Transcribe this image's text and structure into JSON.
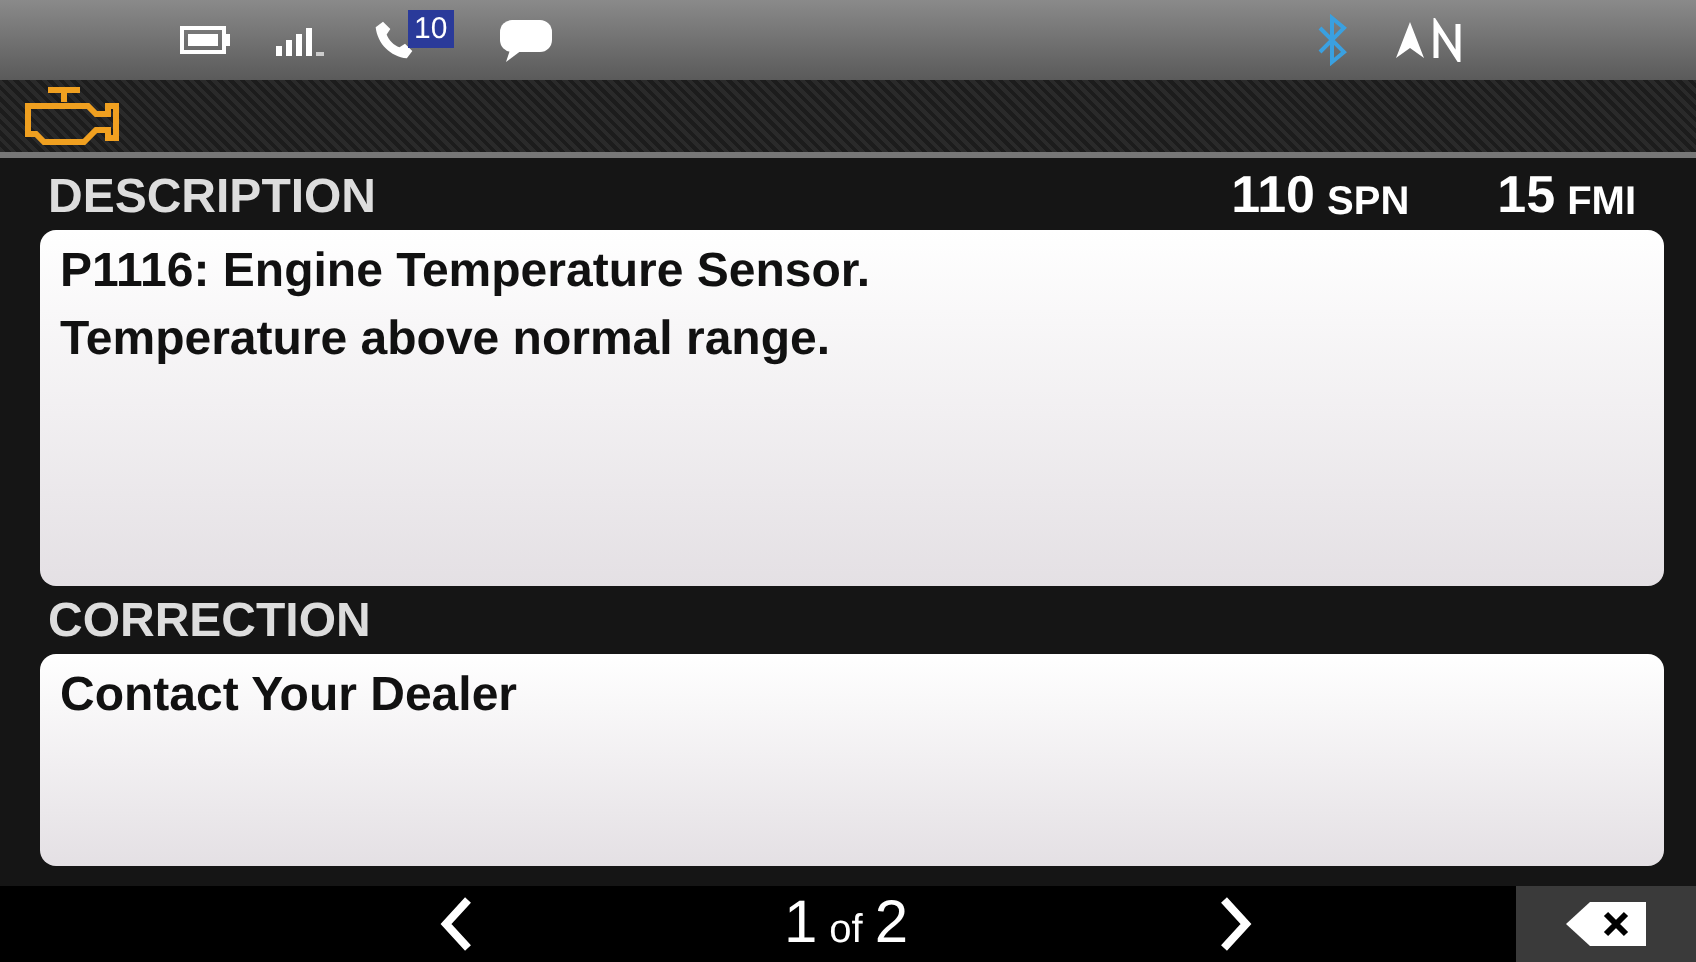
{
  "status_bar": {
    "missed_calls": "10"
  },
  "fault": {
    "description_label": "DESCRIPTION",
    "spn": {
      "value": "110",
      "unit": "SPN"
    },
    "fmi": {
      "value": "15",
      "unit": "FMI"
    },
    "description": [
      "P1116: Engine Temperature Sensor.",
      "Temperature above normal range."
    ],
    "correction_label": "CORRECTION",
    "correction": "Contact Your Dealer"
  },
  "pager": {
    "current": "1",
    "of": "of",
    "total": "2"
  }
}
